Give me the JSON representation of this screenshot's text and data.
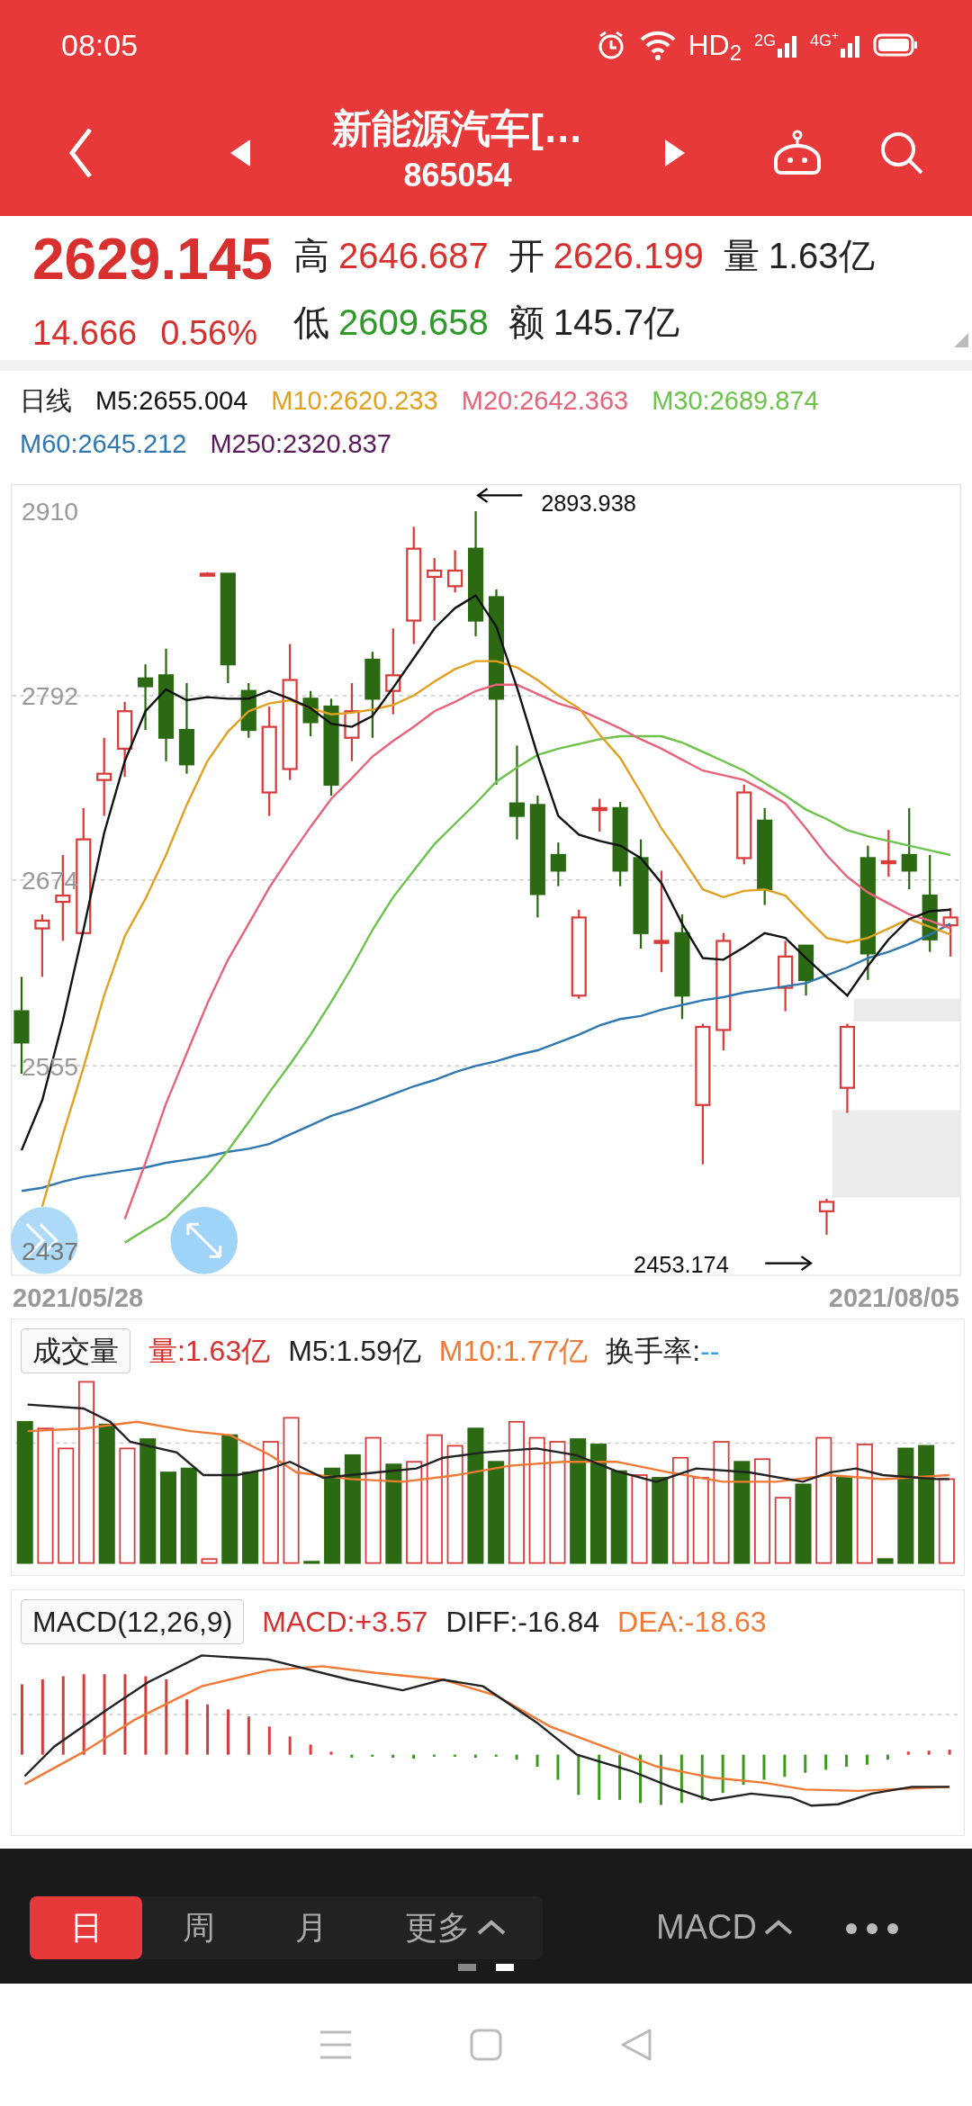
{
  "status_bar": {
    "time": "08:05",
    "hd": "HD$_{2}$",
    "signals": [
      "2G",
      "4G$^{+}$"
    ]
  },
  "header": {
    "title": "新能源汽车[…",
    "code": "865054"
  },
  "quote": {
    "price": "2629.145",
    "change": "14.666",
    "change_pct": "0.56%",
    "stats": [
      {
        "label": "高",
        "value": "2646.687",
        "color": "#d7302e"
      },
      {
        "label": "开",
        "value": "2626.199",
        "color": "#d7302e"
      },
      {
        "label": "量",
        "value": "1.63亿",
        "color": "#222222"
      },
      {
        "label": "低",
        "value": "2609.658",
        "color": "#2e9a27"
      },
      {
        "label": "额",
        "value": "145.7亿",
        "color": "#222222"
      }
    ]
  },
  "chart": {
    "period": "日线",
    "high_note": "2893.938",
    "low_note": "2453.174",
    "dates": [
      "2021/05/28",
      "2021/08/05"
    ],
    "chart_data": {
      "type": "candlestick",
      "ylim": [
        2421,
        2927
      ],
      "ohlc": [
        [
          2590,
          2612,
          2550,
          2570
        ],
        [
          2643,
          2652,
          2612,
          2648
        ],
        [
          2660,
          2690,
          2635,
          2664
        ],
        [
          2640,
          2720,
          2640,
          2700
        ],
        [
          2738,
          2765,
          2715,
          2742
        ],
        [
          2758,
          2788,
          2740,
          2782
        ],
        [
          2803,
          2812,
          2770,
          2798
        ],
        [
          2805,
          2822,
          2750,
          2765
        ],
        [
          2770,
          2800,
          2742,
          2748
        ],
        [
          2870,
          2871,
          2869,
          2870
        ],
        [
          2870,
          2870,
          2800,
          2812
        ],
        [
          2795,
          2800,
          2765,
          2770
        ],
        [
          2730,
          2785,
          2715,
          2772
        ],
        [
          2745,
          2825,
          2738,
          2802
        ],
        [
          2790,
          2795,
          2766,
          2775
        ],
        [
          2785,
          2790,
          2728,
          2735
        ],
        [
          2765,
          2800,
          2750,
          2782
        ],
        [
          2815,
          2820,
          2765,
          2790
        ],
        [
          2795,
          2835,
          2780,
          2805
        ],
        [
          2840,
          2900,
          2825,
          2886
        ],
        [
          2868,
          2880,
          2840,
          2872
        ],
        [
          2862,
          2885,
          2858,
          2872
        ],
        [
          2886,
          2910,
          2830,
          2840
        ],
        [
          2855,
          2860,
          2735,
          2790
        ],
        [
          2723,
          2760,
          2700,
          2715
        ],
        [
          2722,
          2728,
          2650,
          2665
        ],
        [
          2690,
          2698,
          2670,
          2680
        ],
        [
          2600,
          2655,
          2598,
          2650
        ],
        [
          2720,
          2726,
          2705,
          2720
        ],
        [
          2720,
          2724,
          2670,
          2680
        ],
        [
          2688,
          2700,
          2630,
          2640
        ],
        [
          2635,
          2680,
          2615,
          2635
        ],
        [
          2640,
          2652,
          2585,
          2600
        ],
        [
          2530,
          2582,
          2492,
          2580
        ],
        [
          2578,
          2640,
          2565,
          2635
        ],
        [
          2688,
          2735,
          2684,
          2730
        ],
        [
          2712,
          2720,
          2658,
          2668
        ],
        [
          2605,
          2635,
          2590,
          2625
        ],
        [
          2632,
          2632,
          2600,
          2610
        ],
        [
          2462,
          2470,
          2447,
          2468
        ],
        [
          2541,
          2582,
          2525,
          2580
        ],
        [
          2688,
          2696,
          2610,
          2627
        ],
        [
          2686,
          2706,
          2676,
          2686
        ],
        [
          2690,
          2720,
          2668,
          2680
        ],
        [
          2664,
          2690,
          2628,
          2636
        ],
        [
          2645,
          2656,
          2625,
          2650
        ]
      ]
    },
    "moving_averages": {
      "extra": [
        {
          "text": "M250:2320.837",
          "color": "#5a1a5a"
        }
      ],
      "chart_data": {
        "type": "line",
        "ylim": [
          2421,
          2927
        ],
        "yticks": [
          2910,
          2792,
          2674,
          2555,
          2437
        ],
        "series": [
          {
            "name": "M5:2655.004",
            "color": "#111111",
            "values": [
              2501,
              2533,
              2584,
              2642,
              2704,
              2750,
              2782,
              2796,
              2789,
              2791,
              2790,
              2790,
              2795,
              2790,
              2784,
              2774,
              2772,
              2779,
              2797,
              2816,
              2835,
              2848,
              2856,
              2836,
              2797,
              2754,
              2715,
              2703,
              2699,
              2696,
              2688,
              2672,
              2646,
              2624,
              2623,
              2631,
              2640,
              2637,
              2624,
              2612,
              2600,
              2619,
              2636,
              2649,
              2654,
              2655
            ]
          },
          {
            "name": "M10:2620.233",
            "color": "#e0a020",
            "values": [
              null,
              2465,
              2511,
              2554,
              2600,
              2638,
              2662,
              2690,
              2722,
              2750,
              2769,
              2782,
              2787,
              2789,
              2784,
              2780,
              2781,
              2783,
              2786,
              2792,
              2801,
              2809,
              2814,
              2814,
              2810,
              2802,
              2792,
              2784,
              2767,
              2752,
              2730,
              2707,
              2688,
              2668,
              2663,
              2667,
              2668,
              2664,
              2650,
              2637,
              2634,
              2637,
              2643,
              2649,
              2644,
              2639
            ]
          },
          {
            "name": "M20:2642.363",
            "color": "#e8637a",
            "values": [
              null,
              null,
              null,
              null,
              null,
              2457,
              2493,
              2531,
              2563,
              2595,
              2623,
              2646,
              2669,
              2689,
              2708,
              2726,
              2739,
              2753,
              2763,
              2772,
              2782,
              2788,
              2795,
              2799,
              2799,
              2793,
              2787,
              2783,
              2777,
              2771,
              2764,
              2758,
              2751,
              2744,
              2741,
              2738,
              2731,
              2723,
              2707,
              2690,
              2676,
              2666,
              2659,
              2652,
              2648,
              2643
            ]
          },
          {
            "name": "M30:2689.874",
            "color": "#6cc24a",
            "values": [
              null,
              null,
              null,
              null,
              null,
              2442,
              2450,
              2458,
              2471,
              2485,
              2501,
              2519,
              2538,
              2556,
              2575,
              2596,
              2618,
              2642,
              2663,
              2680,
              2697,
              2710,
              2723,
              2737,
              2746,
              2754,
              2758,
              2761,
              2764,
              2766,
              2766,
              2766,
              2762,
              2756,
              2750,
              2744,
              2736,
              2728,
              2719,
              2713,
              2706,
              2702,
              2699,
              2696,
              2693,
              2690
            ]
          },
          {
            "name": "M60:2645.212",
            "color": "#2f77b0",
            "values": [
              2475,
              2477,
              2481,
              2484,
              2486,
              2488,
              2490,
              2493,
              2495,
              2497,
              2500,
              2502,
              2505,
              2511,
              2517,
              2523,
              2527,
              2532,
              2537,
              2542,
              2546,
              2551,
              2555,
              2558,
              2562,
              2565,
              2570,
              2575,
              2581,
              2585,
              2587,
              2591,
              2594,
              2597,
              2599,
              2602,
              2604,
              2606,
              2608,
              2613,
              2618,
              2624,
              2628,
              2633,
              2639,
              2646
            ]
          }
        ]
      }
    }
  },
  "volume": {
    "title": "成交量",
    "items": [
      {
        "text": "量:1.63亿",
        "color": "#d7302e"
      },
      {
        "text": "M5:1.59亿",
        "color": "#222222"
      },
      {
        "text": "M10:1.77亿",
        "color": "#f07a35"
      },
      {
        "text": "换手率:",
        "color": "#222222"
      },
      {
        "text": "--",
        "color": "#3aa0e0"
      }
    ]
  },
  "macd": {
    "title": "MACD(12,26,9)",
    "items": [
      {
        "text": "MACD:+3.57",
        "color": "#d7302e"
      },
      {
        "text": "DIFF:-16.84",
        "color": "#222222"
      },
      {
        "text": "DEA:-18.63",
        "color": "#f07a35"
      }
    ]
  },
  "toolbar": {
    "periods": [
      {
        "label": "日",
        "selected": true,
        "kind": "plain"
      },
      {
        "label": "周",
        "selected": false,
        "kind": "plain"
      },
      {
        "label": "月",
        "selected": false,
        "kind": "plain"
      },
      {
        "label": "更多",
        "selected": false,
        "kind": "menu"
      }
    ],
    "indicator": "MACD",
    "pages": [
      {
        "selected": false
      },
      {
        "selected": true
      }
    ]
  }
}
